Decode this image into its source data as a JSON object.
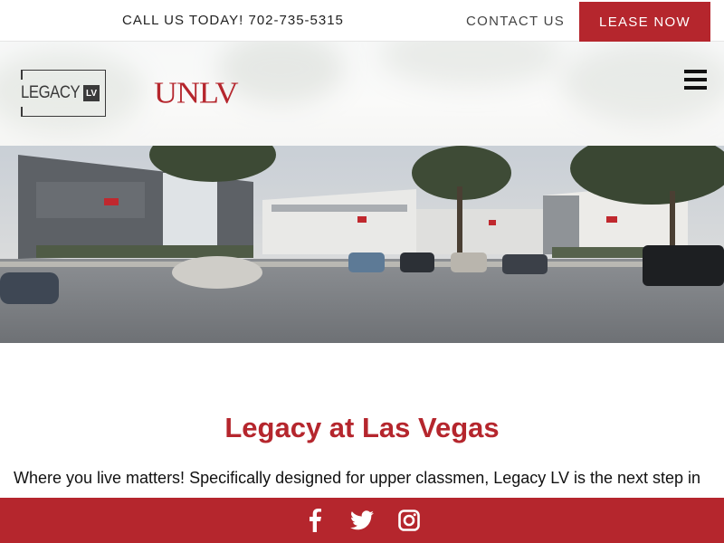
{
  "topbar": {
    "call_text": "CALL US TODAY! 702-735-5315",
    "contact_label": "CONTACT US",
    "lease_label": "LEASE NOW"
  },
  "header": {
    "legacy_logo_text": "LEGACY",
    "legacy_logo_badge": "LV",
    "unlv_logo_text": "UNLV",
    "menu_icon": "hamburger-menu-icon"
  },
  "hero": {
    "image": "apartment-complex-parking-lot-photo"
  },
  "main": {
    "title": "Legacy at Las Vegas",
    "intro": "Where you live matters! Specifically designed for upper classmen, Legacy LV is the next step in"
  },
  "social": {
    "icons": [
      "facebook-icon",
      "twitter-icon",
      "instagram-icon"
    ]
  },
  "colors": {
    "brand_red": "#b5262d",
    "text_dark": "#111111"
  }
}
